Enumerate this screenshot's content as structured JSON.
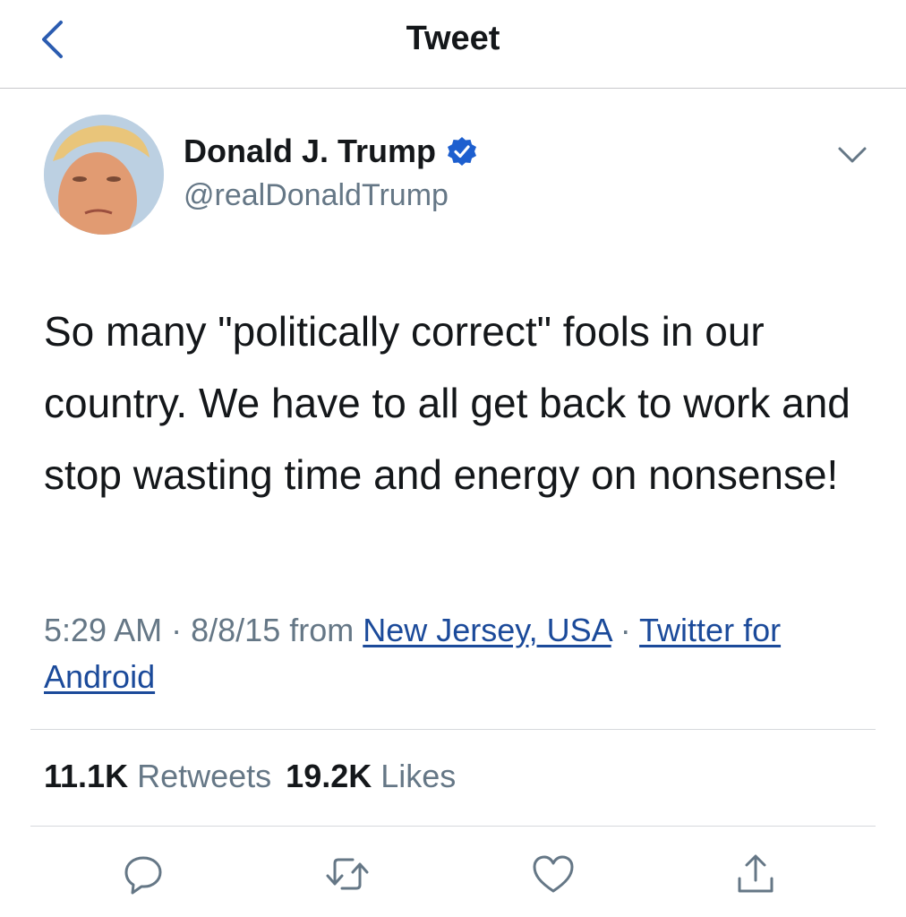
{
  "header": {
    "title": "Tweet",
    "back_icon": "chevron-left-icon"
  },
  "author": {
    "display_name": "Donald J. Trump",
    "handle": "@realDonaldTrump",
    "verified_icon": "verified-badge-icon",
    "menu_icon": "chevron-down-icon"
  },
  "tweet": {
    "text": "So many \"politically correct\" fools in our country. We have to all get back to work and stop wasting time and energy on nonsense!"
  },
  "meta": {
    "time": "5:29 AM",
    "separator": "·",
    "date": "8/8/15",
    "from_label": "from",
    "location": "New Jersey, USA",
    "source": "Twitter for Android"
  },
  "stats": {
    "retweets_count": "11.1K",
    "retweets_label": "Retweets",
    "likes_count": "19.2K",
    "likes_label": "Likes"
  },
  "actions": [
    "reply-icon",
    "retweet-icon",
    "like-icon",
    "share-icon"
  ],
  "colors": {
    "accent": "#1b4a9a",
    "text": "#14171a",
    "secondary": "#657786",
    "verified": "#1d5fcf"
  }
}
